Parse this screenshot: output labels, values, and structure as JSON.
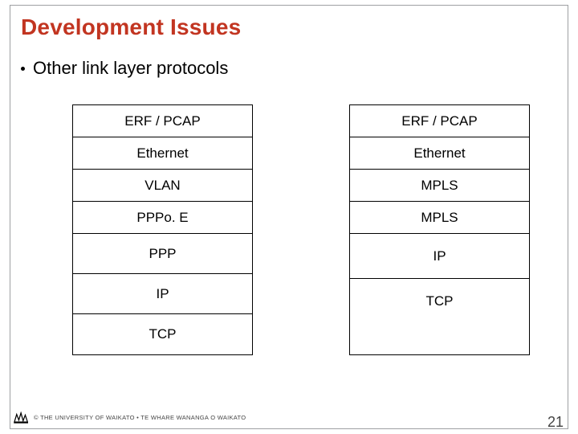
{
  "title": "Development Issues",
  "bullet": "Other link layer protocols",
  "left_stack": [
    "ERF / PCAP",
    "Ethernet",
    "VLAN",
    "PPPo. E",
    "PPP",
    "IP",
    "TCP"
  ],
  "right_stack": [
    "ERF / PCAP",
    "Ethernet",
    "MPLS",
    "MPLS",
    "IP",
    "TCP"
  ],
  "footer": "© THE UNIVERSITY OF WAIKATO  •  TE WHARE WANANGA O WAIKATO",
  "slide_number": "21",
  "logo_name": "wand-logo"
}
